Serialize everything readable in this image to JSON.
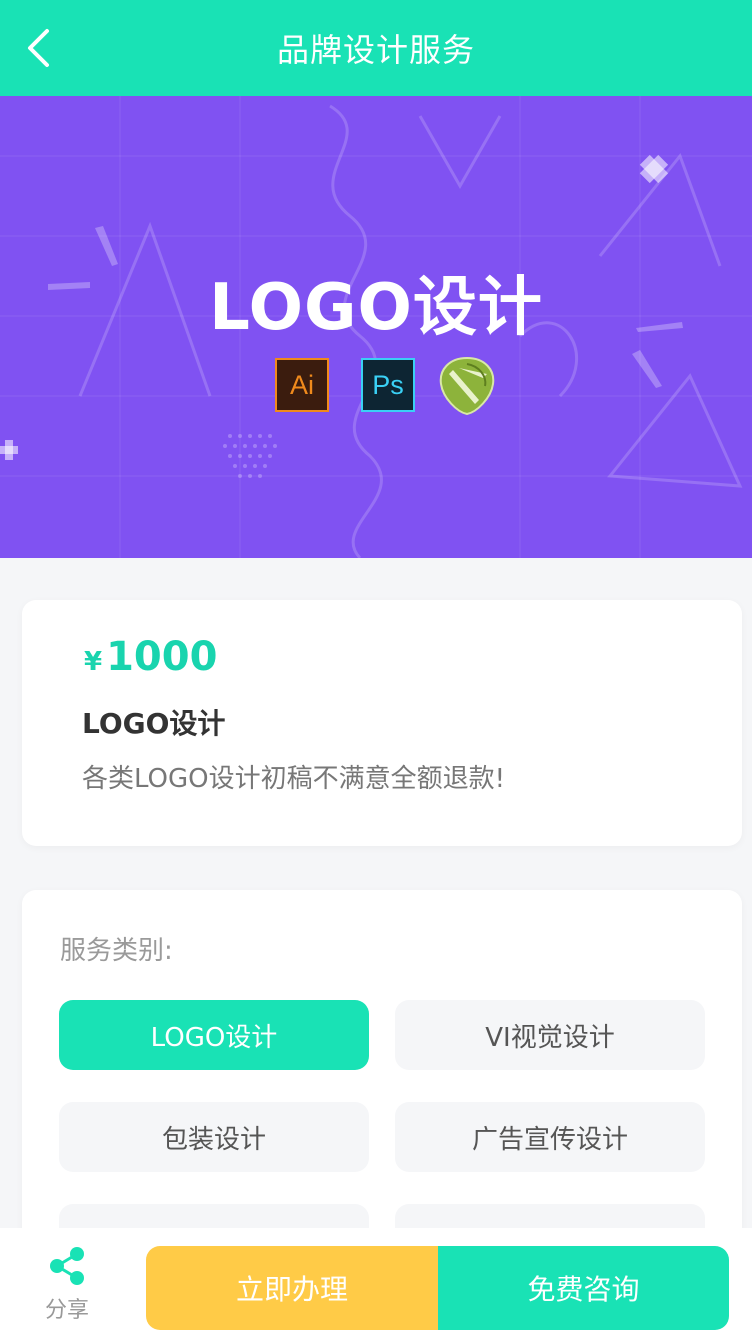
{
  "header": {
    "title": "品牌设计服务",
    "back_icon": "chevron-left-icon",
    "bg_color": "#19e2b5"
  },
  "banner": {
    "title": "LOGO设计",
    "bg_color": "#8052f2",
    "tools": [
      {
        "label": "Ai",
        "icon": "illustrator-icon"
      },
      {
        "label": "Ps",
        "icon": "photoshop-icon"
      },
      {
        "label": "",
        "icon": "coreldraw-icon"
      }
    ]
  },
  "product": {
    "currency": "¥",
    "price": "1000",
    "title": "LOGO设计",
    "description": "各类LOGO设计初稿不满意全额退款!"
  },
  "service": {
    "label": "服务类别:",
    "options": [
      {
        "label": "LOGO设计",
        "selected": true
      },
      {
        "label": "VI视觉设计",
        "selected": false
      },
      {
        "label": "包装设计",
        "selected": false
      },
      {
        "label": "广告宣传设计",
        "selected": false
      },
      {
        "label": "",
        "selected": false
      },
      {
        "label": "",
        "selected": false
      }
    ]
  },
  "bottom_bar": {
    "share_label": "分享",
    "share_icon": "share-icon",
    "apply_label": "立即办理",
    "consult_label": "免费咨询"
  },
  "colors": {
    "accent": "#19e2b5",
    "apply": "#ffcb47",
    "price": "#19d4ae"
  }
}
